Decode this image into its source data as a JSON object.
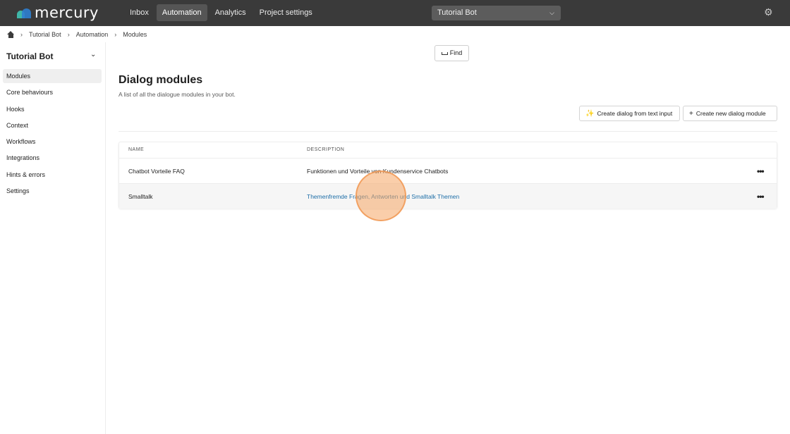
{
  "app": {
    "logo_text": "mercury",
    "nav": [
      {
        "label": "Inbox"
      },
      {
        "label": "Automation"
      },
      {
        "label": "Analytics"
      },
      {
        "label": "Project settings"
      }
    ],
    "bot_selector": "Tutorial Bot"
  },
  "breadcrumb": [
    "Tutorial Bot",
    "Automation",
    "Modules"
  ],
  "sidebar": {
    "title": "Tutorial Bot",
    "items": [
      {
        "label": "Modules"
      },
      {
        "label": "Core behaviours"
      },
      {
        "label": "Hooks"
      },
      {
        "label": "Context"
      },
      {
        "label": "Workflows"
      },
      {
        "label": "Integrations"
      },
      {
        "label": "Hints & errors"
      },
      {
        "label": "Settings"
      }
    ]
  },
  "main": {
    "find_label": "Find",
    "title": "Dialog modules",
    "subtitle": "A list of all the dialogue modules in your bot.",
    "btn_ai": "Create dialog from text input",
    "btn_new": "Create new dialog module",
    "table": {
      "headers": {
        "name": "NAME",
        "description": "DESCRIPTION"
      },
      "rows": [
        {
          "name": "Chatbot Vorteile FAQ",
          "description": "Funktionen und Vorteile von Kundenservice Chatbots"
        },
        {
          "name": "Smalltalk",
          "description": "Themenfremde Fragen, Antworten und Smalltalk Themen"
        }
      ]
    }
  }
}
